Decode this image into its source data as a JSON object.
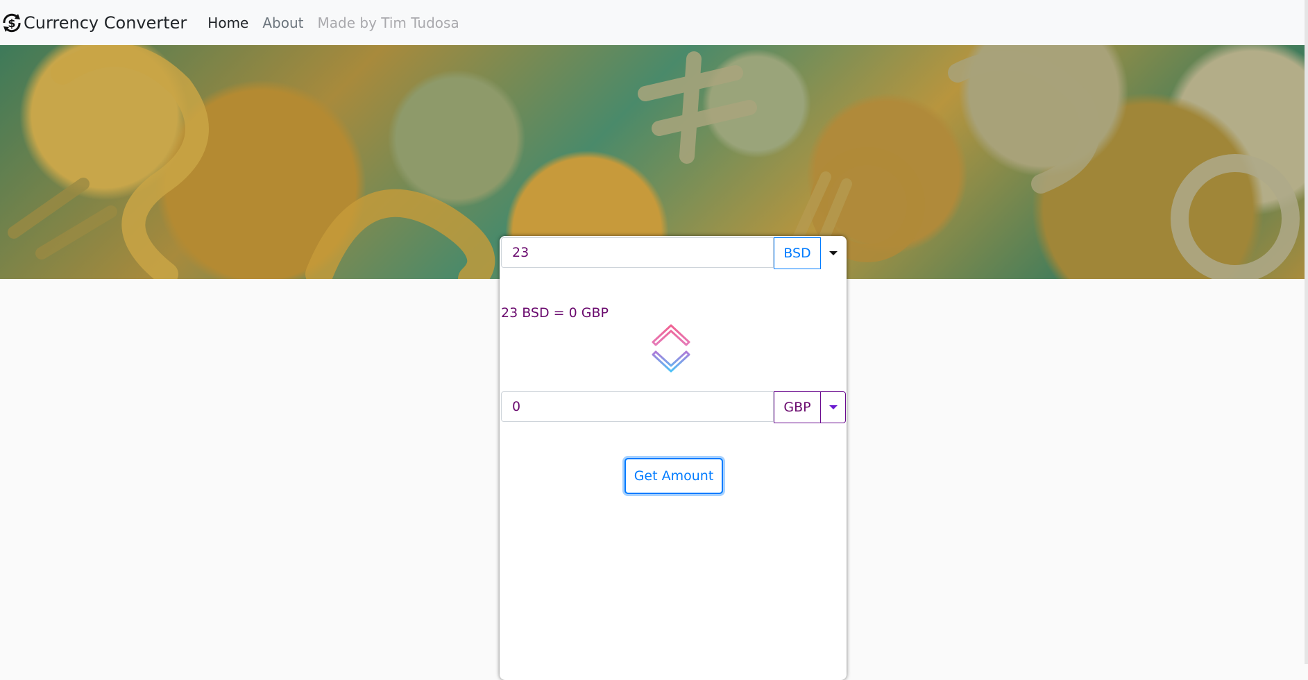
{
  "navbar": {
    "brand": "Currency Converter",
    "links": {
      "home": "Home",
      "about": "About",
      "credit": "Made by Tim Tudosa"
    }
  },
  "converter": {
    "from": {
      "amount": "23",
      "currency": "BSD"
    },
    "result_text": "23 BSD = 0 GBP",
    "to": {
      "amount": "0",
      "currency": "GBP"
    },
    "button_label": "Get Amount"
  },
  "colors": {
    "accent_blue": "#007bff",
    "text_purple": "#6a0a6e",
    "swap_up": "#e85d9c",
    "swap_down": "#a36bd8"
  },
  "icons": {
    "brand": "currency-exchange-icon",
    "swap": "swap-arrows-icon",
    "caret": "caret-down-icon"
  }
}
